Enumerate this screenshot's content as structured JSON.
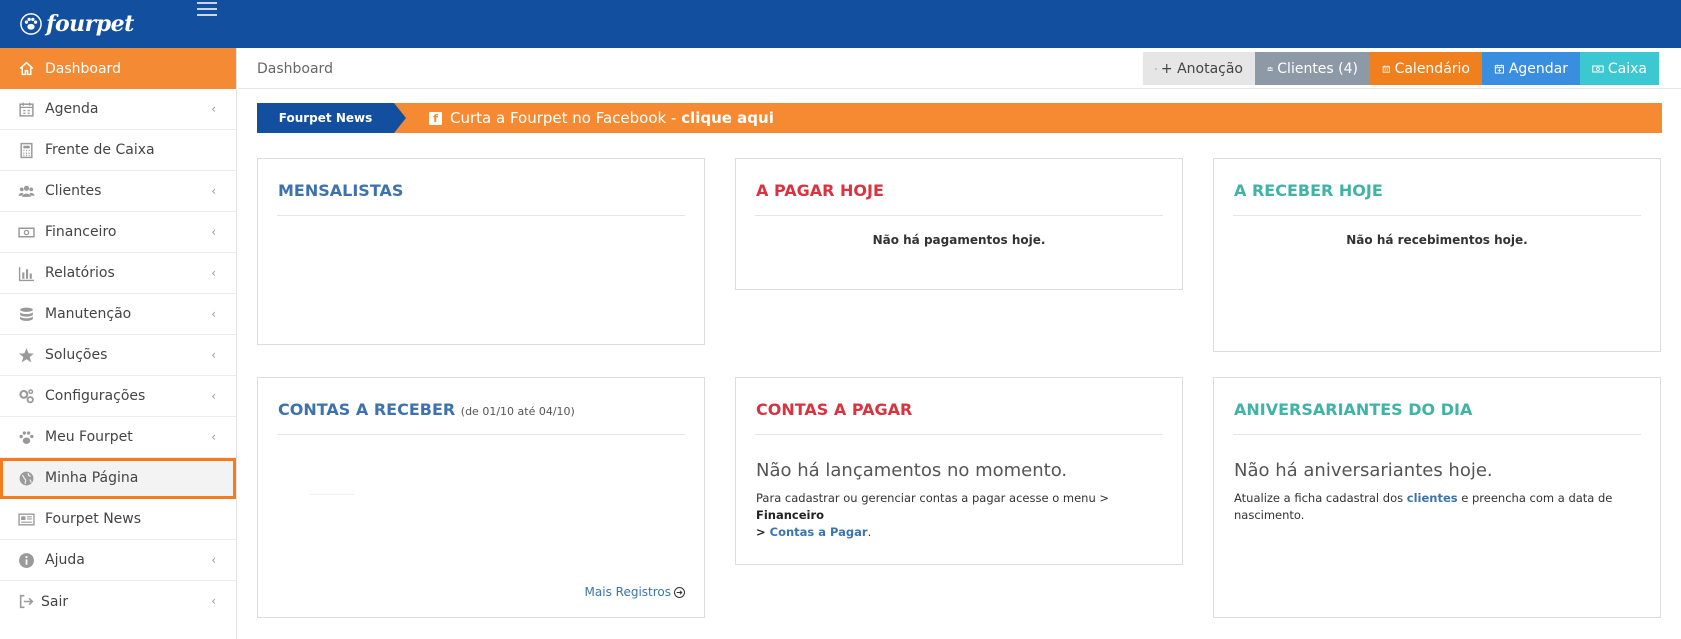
{
  "app": {
    "logo_text": "fourpet"
  },
  "sidebar": {
    "items": [
      {
        "label": "Dashboard"
      },
      {
        "label": "Agenda"
      },
      {
        "label": "Frente de Caixa"
      },
      {
        "label": "Clientes"
      },
      {
        "label": "Financeiro"
      },
      {
        "label": "Relatórios"
      },
      {
        "label": "Manutenção"
      },
      {
        "label": "Soluções"
      },
      {
        "label": "Configurações"
      },
      {
        "label": "Meu Fourpet"
      },
      {
        "label": "Minha Página"
      },
      {
        "label": "Fourpet News"
      },
      {
        "label": "Ajuda"
      },
      {
        "label": "Sair"
      }
    ]
  },
  "breadcrumb": {
    "current": "Dashboard"
  },
  "toolbar": {
    "anotacao_label": "+ Anotação",
    "clientes_label": "Clientes (4)",
    "calendario_label": "Calendário",
    "agendar_label": "Agendar",
    "caixa_label": "Caixa"
  },
  "news": {
    "label": "Fourpet News",
    "text": "Curta a Fourpet no Facebook - ",
    "link": "clique aqui"
  },
  "cards": {
    "mensalistas": {
      "title": "MENSALISTAS"
    },
    "a_pagar_hoje": {
      "title": "A PAGAR HOJE",
      "empty": "Não há pagamentos hoje."
    },
    "a_receber_hoje": {
      "title": "A RECEBER HOJE",
      "empty": "Não há recebimentos hoje."
    },
    "contas_receber": {
      "title": "CONTAS A RECEBER",
      "range": "(de 01/10 até 04/10)",
      "more": "Mais Registros"
    },
    "contas_pagar": {
      "title": "CONTAS A PAGAR",
      "message": "Não há lançamentos no momento.",
      "help_prefix": "Para cadastrar ou gerenciar contas a pagar acesse o menu > ",
      "help_menu": "Financeiro",
      "help_sep": " > ",
      "help_link": "Contas a Pagar",
      "help_suffix": "."
    },
    "aniversariantes": {
      "title": "ANIVERSARIANTES DO DIA",
      "message": "Não há aniversariantes hoje.",
      "help_prefix": "Atualize a ficha cadastral dos ",
      "help_link": "clientes",
      "help_suffix": " e preencha com a data de nascimento."
    }
  },
  "colors": {
    "topbar": "#124f9e",
    "accent_orange": "#f48a34",
    "btn_anotacao": "#e6e6e6",
    "btn_clientes": "#8e99a8",
    "btn_calendario": "#f07f1d",
    "btn_agendar": "#3a8ee0",
    "btn_caixa": "#3cc8d0",
    "title_blue": "#3e72ad",
    "title_red": "#d9333f",
    "title_teal": "#3fb3a5"
  }
}
